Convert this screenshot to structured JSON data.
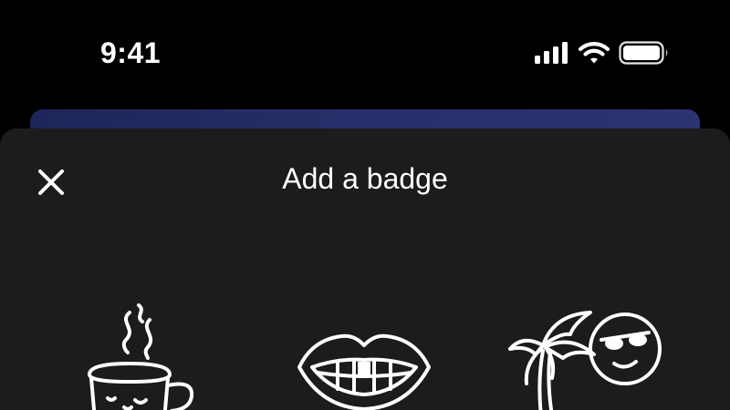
{
  "status_bar": {
    "time": "9:41",
    "icons": [
      "cellular-signal-icon",
      "wifi-icon",
      "battery-icon"
    ]
  },
  "sheet": {
    "title": "Add a badge",
    "close_icon": "close-icon"
  },
  "badges": [
    {
      "icon": "coffee-cup-icon"
    },
    {
      "icon": "gap-tooth-smile-icon"
    },
    {
      "icon": "palm-tree-sun-icon"
    }
  ],
  "colors": {
    "background": "#000000",
    "sheet": "#1c1c1e",
    "card_gradient_start": "#1d2559",
    "card_gradient_end": "#2b3370",
    "foreground": "#ffffff"
  }
}
